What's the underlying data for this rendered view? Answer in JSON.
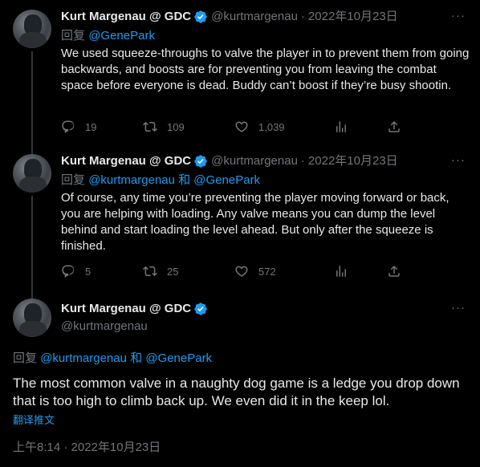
{
  "tweets": [
    {
      "name": "Kurt Margenau @ GDC",
      "handle": "@kurtmargenau",
      "date": "2022年10月23日",
      "more": "···",
      "reply_label": "回复",
      "reply_users": "@GenePark",
      "text": "We used squeeze-throughs to valve the player in to prevent them from going backwards, and boosts are for preventing you from leaving the combat space before everyone is dead. Buddy can’t boost if they’re busy shootin.",
      "replies": "19",
      "retweets": "109",
      "likes": "1,039"
    },
    {
      "name": "Kurt Margenau @ GDC",
      "handle": "@kurtmargenau",
      "date": "2022年10月23日",
      "more": "···",
      "reply_label": "回复",
      "reply_users": "@kurtmargenau 和 @GenePark",
      "text": "Of course, any time you’re preventing the player moving forward or back, you are helping with loading. Any valve means you can dump the level behind and start loading the level ahead. But only after the squeeze is finished.",
      "replies": "5",
      "retweets": "25",
      "likes": "572"
    }
  ],
  "main": {
    "name": "Kurt Margenau @ GDC",
    "handle": "@kurtmargenau",
    "more": "···",
    "reply_label": "回复",
    "reply_users": "@kurtmargenau 和 @GenePark",
    "text": "The most common valve in a naughty dog game is a ledge you drop down that is too high to climb back up. We even did it in the keep lol.",
    "translate": "翻译推文",
    "timestamp": "上午8:14 · 2022年10月23日"
  },
  "colors": {
    "background": "#000000",
    "text": "#e7e9ea",
    "secondary": "#71767b",
    "link": "#1d9bf0",
    "verified": "#1d9bf0"
  },
  "icons": [
    "verified-badge-icon",
    "more-icon",
    "reply-icon",
    "retweet-icon",
    "like-icon",
    "analytics-icon",
    "share-icon"
  ]
}
